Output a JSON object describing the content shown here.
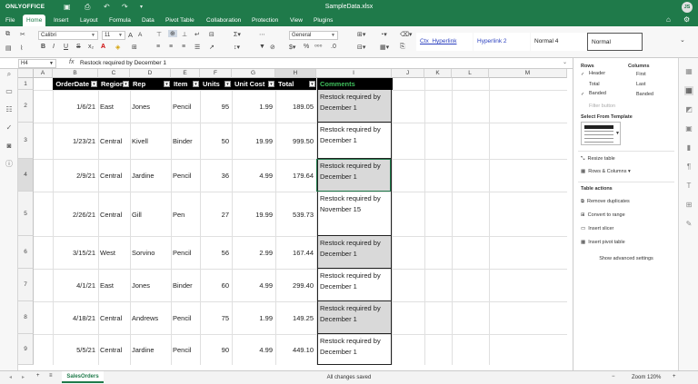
{
  "app": {
    "logo": "ONLYOFFICE",
    "file_name": "SampleData.xlsx",
    "user_initials": "JS"
  },
  "menu_tabs": [
    "File",
    "Home",
    "Insert",
    "Layout",
    "Formula",
    "Data",
    "Pivot Table",
    "Collaboration",
    "Protection",
    "View",
    "Plugins"
  ],
  "active_tab": "Home",
  "toolbar": {
    "font_name": "Calibri",
    "font_size": "11",
    "number_format": "General",
    "styles": [
      "Ctx_Hyperlink",
      "Hyperlink 2",
      "Normal 4",
      "Normal"
    ],
    "selected_style": "Normal"
  },
  "formula_bar": {
    "cell_ref": "H4",
    "fx": "fx",
    "content": "Restock required by December 1"
  },
  "columns": [
    "A",
    "B",
    "C",
    "D",
    "E",
    "F",
    "G",
    "H",
    "I",
    "J",
    "K",
    "L",
    "M"
  ],
  "selected_column": "H",
  "rows": [
    "1",
    "2",
    "3",
    "4",
    "5",
    "6",
    "7",
    "8",
    "9"
  ],
  "selected_row": "4",
  "table_headers": [
    "OrderDate",
    "Region",
    "Rep",
    "Item",
    "Units",
    "Unit Cost",
    "Total",
    "Comments"
  ],
  "table_rows": [
    {
      "date": "1/6/21",
      "region": "East",
      "rep": "Jones",
      "item": "Pencil",
      "units": "95",
      "cost": "1.99",
      "total": "189.05",
      "c1": "Restock required by",
      "c2": "December 1"
    },
    {
      "date": "1/23/21",
      "region": "Central",
      "rep": "Kivell",
      "item": "Binder",
      "units": "50",
      "cost": "19.99",
      "total": "999.50",
      "c1": "Restock required by",
      "c2": "December 1"
    },
    {
      "date": "2/9/21",
      "region": "Central",
      "rep": "Jardine",
      "item": "Pencil",
      "units": "36",
      "cost": "4.99",
      "total": "179.64",
      "c1": "Restock required by",
      "c2": "December 1"
    },
    {
      "date": "2/26/21",
      "region": "Central",
      "rep": "Gill",
      "item": "Pen",
      "units": "27",
      "cost": "19.99",
      "total": "539.73",
      "c1": "Restock required by",
      "c2": "November 15"
    },
    {
      "date": "3/15/21",
      "region": "West",
      "rep": "Sorvino",
      "item": "Pencil",
      "units": "56",
      "cost": "2.99",
      "total": "167.44",
      "c1": "Restock required by",
      "c2": "December 1"
    },
    {
      "date": "4/1/21",
      "region": "East",
      "rep": "Jones",
      "item": "Binder",
      "units": "60",
      "cost": "4.99",
      "total": "299.40",
      "c1": "Restock required by",
      "c2": "December 1"
    },
    {
      "date": "4/18/21",
      "region": "Central",
      "rep": "Andrews",
      "item": "Pencil",
      "units": "75",
      "cost": "1.99",
      "total": "149.25",
      "c1": "Restock required by",
      "c2": "December 1"
    },
    {
      "date": "5/5/21",
      "region": "Central",
      "rep": "Jardine",
      "item": "Pencil",
      "units": "90",
      "cost": "4.99",
      "total": "449.10",
      "c1": "Restock required by",
      "c2": "December 1"
    }
  ],
  "panel": {
    "rows_title": "Rows",
    "columns_title": "Columns",
    "header": "Header",
    "total": "Total",
    "banded": "Banded",
    "first": "First",
    "last": "Last",
    "banded_col": "Banded",
    "filter_button": "Filter button",
    "checked": {
      "header": true,
      "total": false,
      "banded": true,
      "first": false,
      "last": false,
      "banded_col": false,
      "filter_button": false
    },
    "select_template": "Select From Template",
    "resize_table": "Resize table",
    "rows_columns": "Rows & Columns",
    "table_actions": "Table actions",
    "remove_duplicates": "Remove duplicates",
    "convert_to_range": "Convert to range",
    "insert_slicer": "Insert slicer",
    "insert_pivot": "Insert pivot table",
    "advanced": "Show advanced settings"
  },
  "status": {
    "sheet_tab": "SalesOrders",
    "saved": "All changes saved",
    "zoom": "Zoom 120%"
  },
  "colors": {
    "brand_green": "#1f7a4a",
    "header_bg": "#000000",
    "comments_header": "#3fbf5c",
    "band_gray": "#d9d9d9"
  }
}
